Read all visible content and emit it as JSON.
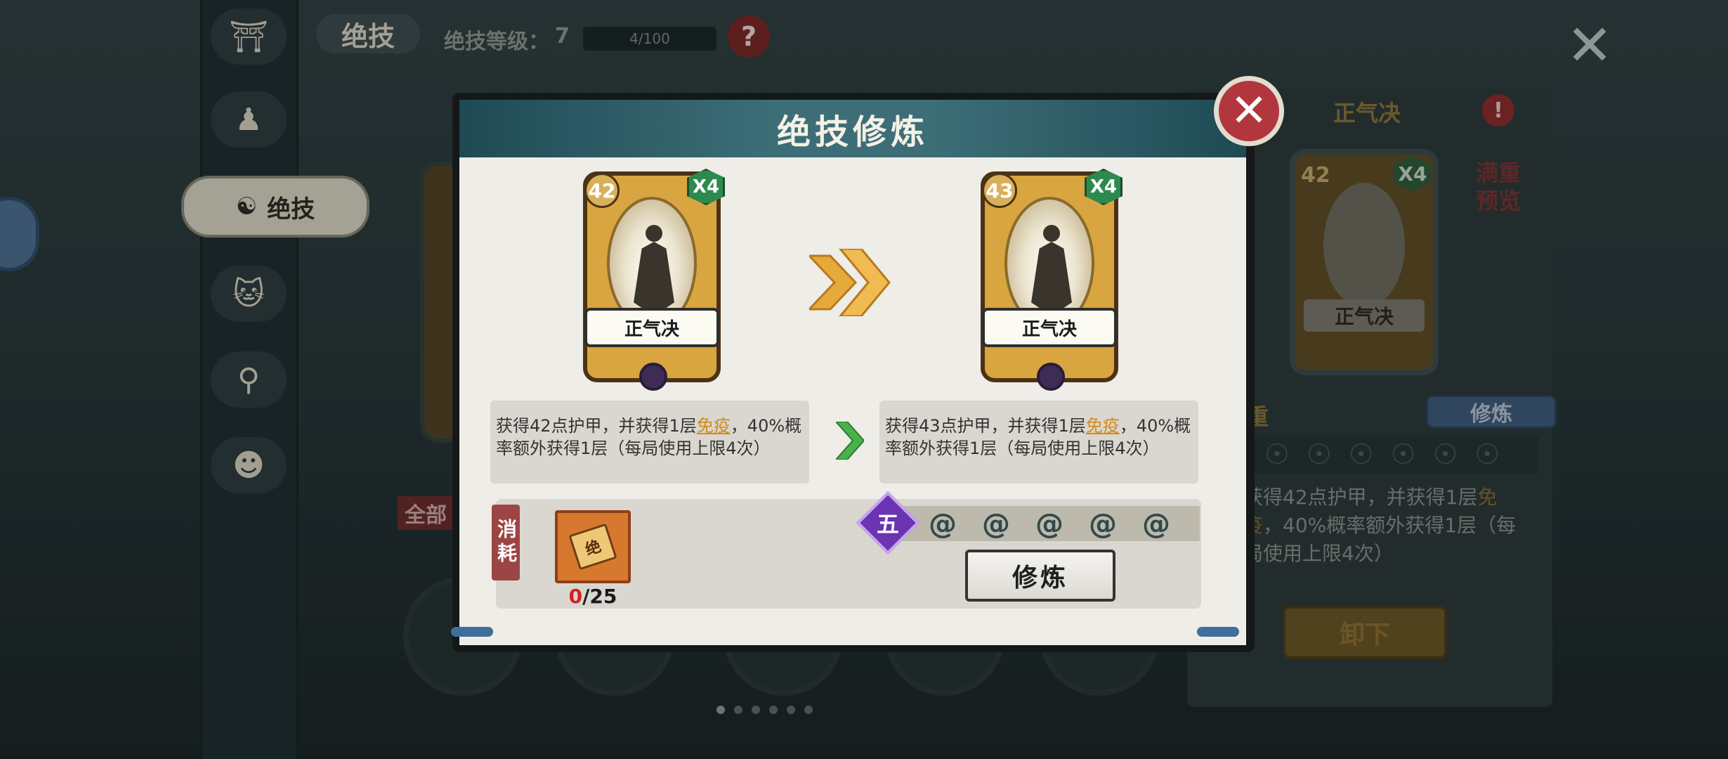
{
  "background": {
    "top_tab": "绝技",
    "level_label": "绝技等级：",
    "level_value": "7",
    "level_progress": "4/100",
    "help_icon": "question-icon",
    "close_icon": "close-icon",
    "sidebar": {
      "active_label": "绝技",
      "items": [
        "pagoda-icon",
        "character-icon",
        "skill-icon",
        "cat-icon",
        "fishing-rod-icon",
        "mask-icon"
      ]
    },
    "all_label": "全部",
    "right_panel": {
      "title": "正气决",
      "card_level": "42",
      "card_multiplier": "X4",
      "card_name": "正气决",
      "preview_label": "满重预览",
      "weight_label": "重",
      "train_button": "修炼",
      "desc_part1": "获得42点护甲，并获得1层",
      "desc_highlight": "免疫",
      "desc_part2": "，40%概率额外获得1层（每局使用上限4次）",
      "unload_button": "卸下"
    },
    "page_dots": 6
  },
  "modal": {
    "title": "绝技修炼",
    "close_icon": "close-icon",
    "current": {
      "level": "42",
      "multiplier": "X4",
      "name": "正气决",
      "desc_part1": "获得42点护甲，并获得1层",
      "desc_highlight": "免疫",
      "desc_part2": "，40%概率额外获得1层（每局使用上限4次）"
    },
    "next": {
      "level": "43",
      "multiplier": "X4",
      "name": "正气决",
      "desc_part1": "获得43点护甲，并获得1层",
      "desc_highlight": "免疫",
      "desc_part2": "，40%概率额外获得1层（每局使用上限4次）"
    },
    "cost": {
      "label": "消耗",
      "item_glyph": "绝",
      "have": "0",
      "need": "/25"
    },
    "stage_badge": "五",
    "stage_slots": 5,
    "train_button": "修炼"
  },
  "colors": {
    "modal_header": "#3d6e77",
    "close_button": "#b2363d",
    "card_gold": "#d8a540",
    "multiplier_green": "#2d8a4e",
    "highlight_orange": "#d48a1d",
    "badge_purple": "#6a34b2",
    "count_red": "#d21f1f"
  }
}
